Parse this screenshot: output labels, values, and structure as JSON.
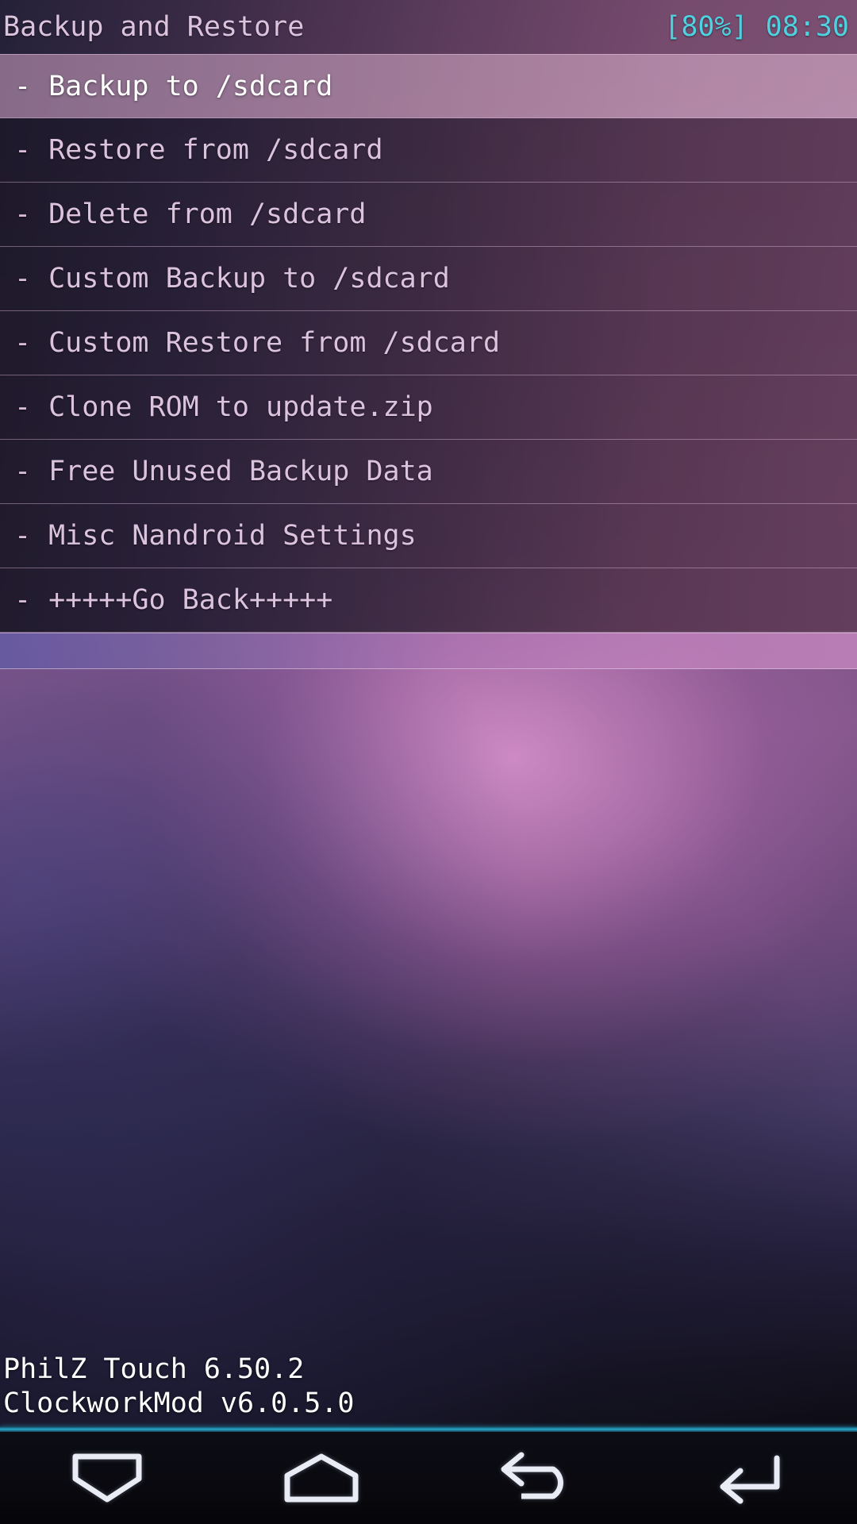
{
  "header": {
    "title": "Backup and Restore",
    "battery": "[80%]",
    "clock": "08:30",
    "accent_color": "#4fd2e0",
    "title_color": "#dcc3dd"
  },
  "menu": {
    "dash": "-",
    "items": [
      {
        "label": "Backup to /sdcard",
        "selected": true
      },
      {
        "label": "Restore from /sdcard",
        "selected": false
      },
      {
        "label": "Delete from /sdcard",
        "selected": false
      },
      {
        "label": "Custom Backup to /sdcard",
        "selected": false
      },
      {
        "label": "Custom Restore from /sdcard",
        "selected": false
      },
      {
        "label": "Clone ROM to update.zip",
        "selected": false
      },
      {
        "label": "Free Unused Backup Data",
        "selected": false
      },
      {
        "label": "Misc Nandroid Settings",
        "selected": false
      },
      {
        "label": "+++++Go Back+++++",
        "selected": false
      }
    ]
  },
  "footer": {
    "line1": "PhilZ Touch 6.50.2",
    "line2": "ClockworkMod v6.0.5.0",
    "text_color": "#ffffff"
  },
  "navbar": {
    "buttons": [
      {
        "icon": "menu-down-icon",
        "label": "Menu"
      },
      {
        "icon": "home-icon",
        "label": "Home"
      },
      {
        "icon": "back-icon",
        "label": "Back"
      },
      {
        "icon": "enter-icon",
        "label": "Enter"
      }
    ],
    "separator_color": "#2aa8c8"
  }
}
